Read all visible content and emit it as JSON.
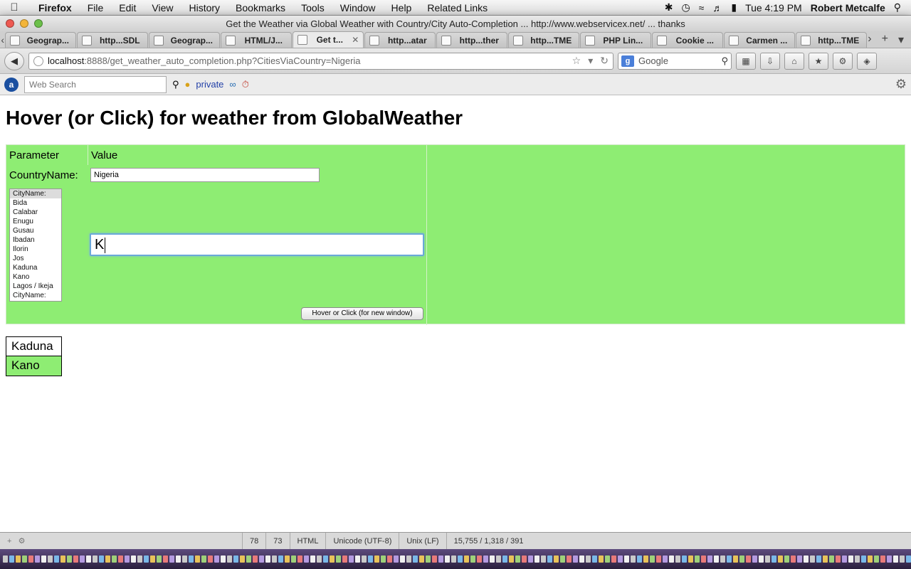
{
  "menubar": {
    "app_name": "Firefox",
    "menus": [
      "File",
      "Edit",
      "View",
      "History",
      "Bookmarks",
      "Tools",
      "Window",
      "Help",
      "Related Links"
    ],
    "clock": "Tue 4:19 PM",
    "user": "Robert Metcalfe"
  },
  "window": {
    "title": "Get the Weather via Global Weather with Country/City Auto-Completion ... http://www.webservicex.net/ ... thanks"
  },
  "tabs": [
    {
      "label": "Geograp..."
    },
    {
      "label": "http...SDL"
    },
    {
      "label": "Geograp..."
    },
    {
      "label": "HTML/J..."
    },
    {
      "label": "Get t...",
      "active": true
    },
    {
      "label": "http...atar"
    },
    {
      "label": "http...ther"
    },
    {
      "label": "http...TME"
    },
    {
      "label": "PHP Lin..."
    },
    {
      "label": "Cookie ..."
    },
    {
      "label": "Carmen ..."
    },
    {
      "label": "http...TME"
    }
  ],
  "urlbar": {
    "host": "localhost",
    "path": ":8888/get_weather_auto_completion.php?CitiesViaCountry=Nigeria"
  },
  "searchbar": {
    "placeholder": "Google"
  },
  "addonbar": {
    "websearch_placeholder": "Web Search",
    "private_label": "private"
  },
  "page": {
    "title": "Hover (or Click) for weather from GlobalWeather",
    "headers": {
      "parameter": "Parameter",
      "value": "Value"
    },
    "country_label": "CountryName:",
    "country_value": "Nigeria",
    "city_options": [
      "CityName:",
      "Bida",
      "Calabar",
      "Enugu",
      "Gusau",
      "Ibadan",
      "Ilorin",
      "Jos",
      "Kaduna",
      "Kano",
      "Lagos / Ikeja",
      "CityName:"
    ],
    "city_input_value": "K",
    "hover_button_label": "Hover or Click (for new window)",
    "suggestions": [
      "Kaduna",
      "Kano"
    ]
  },
  "editor_status": {
    "line": "78",
    "col": "73",
    "mode": "HTML",
    "encoding": "Unicode (UTF-8)",
    "line_endings": "Unix (LF)",
    "stats": "15,755 / 1,318 / 391"
  },
  "colors": {
    "panel_green": "#8eed73",
    "highlight_green": "#8eed73"
  }
}
